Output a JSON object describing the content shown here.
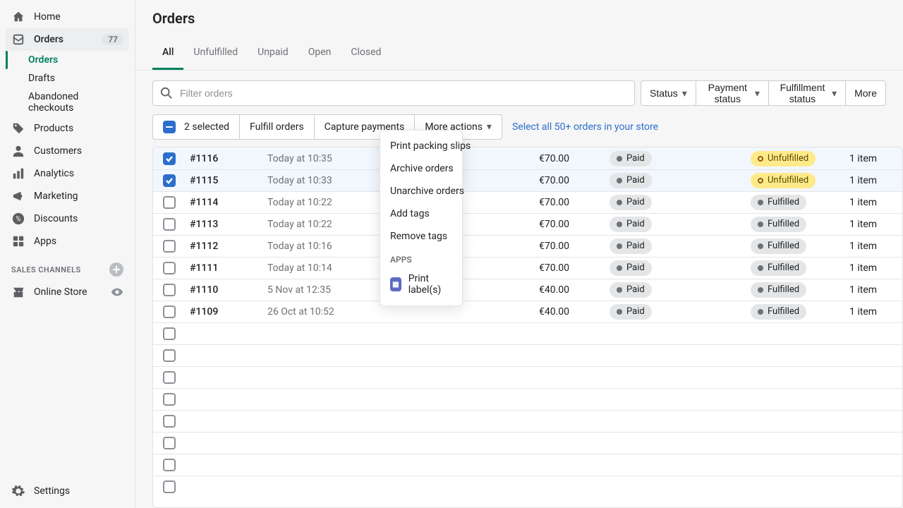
{
  "sidebar": {
    "home": "Home",
    "orders": "Orders",
    "orders_count": "77",
    "orders_sub": [
      "Orders",
      "Drafts",
      "Abandoned checkouts"
    ],
    "products": "Products",
    "customers": "Customers",
    "analytics": "Analytics",
    "marketing": "Marketing",
    "discounts": "Discounts",
    "apps": "Apps",
    "channels_heading": "SALES CHANNELS",
    "online_store": "Online Store",
    "settings": "Settings"
  },
  "page": {
    "title": "Orders"
  },
  "tabs": [
    "All",
    "Unfulfilled",
    "Unpaid",
    "Open",
    "Closed"
  ],
  "search": {
    "placeholder": "Filter orders"
  },
  "filters": {
    "status": "Status",
    "payment": "Payment status",
    "fulfillment": "Fulfillment status",
    "more": "More"
  },
  "bulk": {
    "selected_text": "2 selected",
    "fulfill": "Fulfill orders",
    "capture": "Capture payments",
    "more": "More actions",
    "select_all": "Select all 50+ orders in your store"
  },
  "dropdown": {
    "items": [
      "Print packing slips",
      "Archive orders",
      "Unarchive orders",
      "Add tags",
      "Remove tags"
    ],
    "apps_heading": "APPS",
    "app_item": "Print label(s)"
  },
  "orders": [
    {
      "id": "#1116",
      "date": "Today at 10:35",
      "total": "€70.00",
      "payment": "Paid",
      "fulfillment": "Unfulfilled",
      "items": "1 item",
      "selected": true
    },
    {
      "id": "#1115",
      "date": "Today at 10:33",
      "total": "€70.00",
      "payment": "Paid",
      "fulfillment": "Unfulfilled",
      "items": "1 item",
      "selected": true
    },
    {
      "id": "#1114",
      "date": "Today at 10:22",
      "total": "€70.00",
      "payment": "Paid",
      "fulfillment": "Fulfilled",
      "items": "1 item",
      "selected": false
    },
    {
      "id": "#1113",
      "date": "Today at 10:22",
      "total": "€70.00",
      "payment": "Paid",
      "fulfillment": "Fulfilled",
      "items": "1 item",
      "selected": false
    },
    {
      "id": "#1112",
      "date": "Today at 10:16",
      "total": "€70.00",
      "payment": "Paid",
      "fulfillment": "Fulfilled",
      "items": "1 item",
      "selected": false
    },
    {
      "id": "#1111",
      "date": "Today at 10:14",
      "total": "€70.00",
      "payment": "Paid",
      "fulfillment": "Fulfilled",
      "items": "1 item",
      "selected": false
    },
    {
      "id": "#1110",
      "date": "5 Nov at 12:35",
      "total": "€40.00",
      "payment": "Paid",
      "fulfillment": "Fulfilled",
      "items": "1 item",
      "selected": false
    },
    {
      "id": "#1109",
      "date": "26 Oct at 10:52",
      "total": "€40.00",
      "payment": "Paid",
      "fulfillment": "Fulfilled",
      "items": "1 item",
      "selected": false
    }
  ],
  "empty_rows": 8
}
